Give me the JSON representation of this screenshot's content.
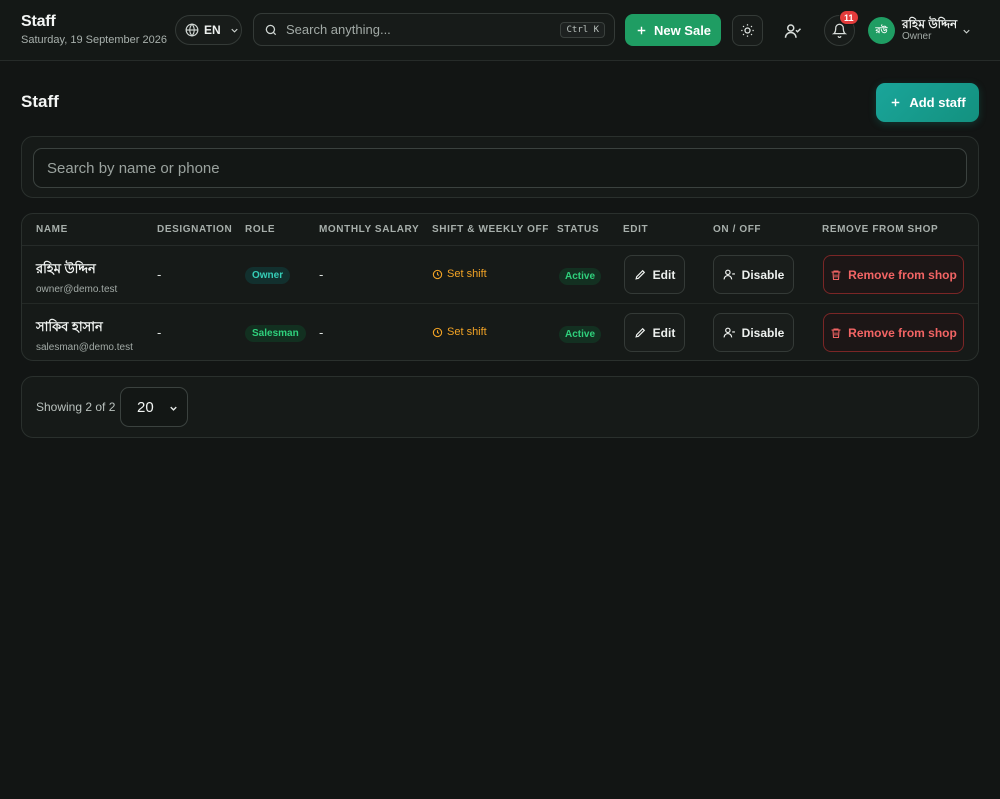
{
  "header": {
    "title": "Staff",
    "date": "Saturday, 19 September 2026",
    "language": "EN",
    "search_placeholder": "Search anything...",
    "search_shortcut": "Ctrl K",
    "new_sale_label": "New Sale",
    "notification_count": "11",
    "user": {
      "initials": "রউ",
      "name": "রহিম উদ্দিন",
      "role": "Owner"
    }
  },
  "page": {
    "title": "Staff",
    "add_staff_label": "Add staff",
    "filter_placeholder": "Search by name or phone"
  },
  "table": {
    "columns": [
      "NAME",
      "DESIGNATION",
      "ROLE",
      "MONTHLY SALARY",
      "SHIFT & WEEKLY OFF",
      "STATUS",
      "EDIT",
      "ON / OFF",
      "REMOVE FROM SHOP"
    ],
    "rows": [
      {
        "name": "রহিম উদ্দিন",
        "email": "owner@demo.test",
        "designation": "-",
        "role": "Owner",
        "salary": "-",
        "shift": "Set shift",
        "status": "Active",
        "edit": "Edit",
        "toggle": "Disable",
        "remove": "Remove from shop"
      },
      {
        "name": "সাকিব হাসান",
        "email": "salesman@demo.test",
        "designation": "-",
        "role": "Salesman",
        "salary": "-",
        "shift": "Set shift",
        "status": "Active",
        "edit": "Edit",
        "toggle": "Disable",
        "remove": "Remove from shop"
      }
    ]
  },
  "pager": {
    "showing": "Showing 2 of 2",
    "page_size": "20"
  },
  "colors": {
    "background": "#121514",
    "primary_green": "#1f9d63",
    "teal": "#1aa59a",
    "warning": "#f2a325",
    "danger": "#f26464",
    "badge_red": "#e23b3b"
  },
  "icons": [
    "globe-icon",
    "chevron-down-icon",
    "search-icon",
    "plus-icon",
    "sun-icon",
    "user-check-icon",
    "bell-icon",
    "clock-icon",
    "pencil-icon",
    "user-minus-icon",
    "trash-icon"
  ]
}
